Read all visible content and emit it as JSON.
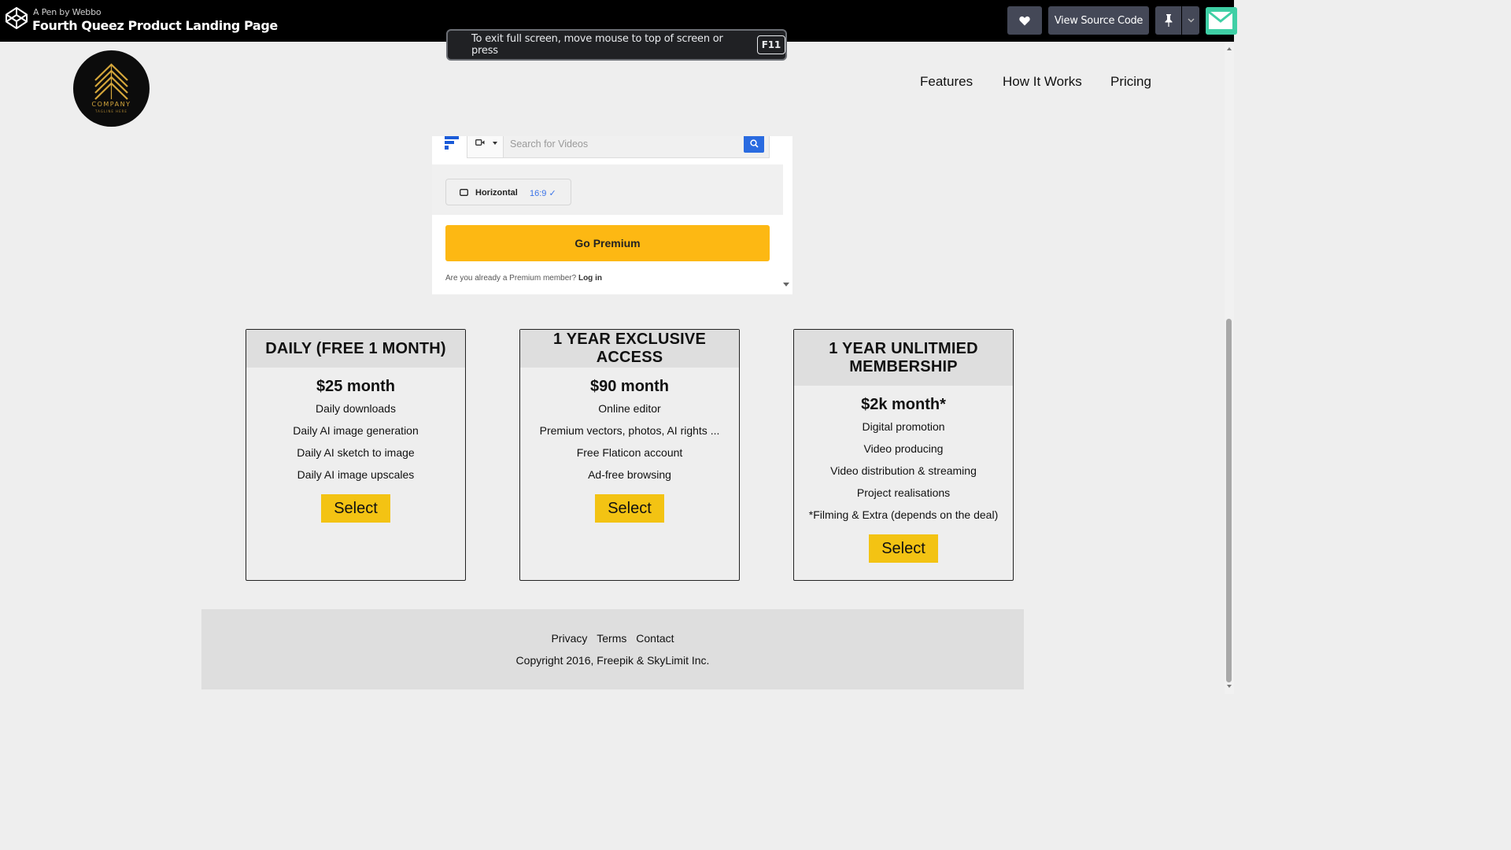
{
  "codepen": {
    "byline": "A Pen by Webbo",
    "title": "Fourth Queez Product Landing Page",
    "view_source_label": "View Source Code"
  },
  "fullscreen_notice": {
    "text": "To exit full screen, move mouse to top of screen or press",
    "key": "F11"
  },
  "site": {
    "logo_text": "COMPANY",
    "logo_tagline": "TAGLINE HERE",
    "nav": [
      "Features",
      "How It Works",
      "Pricing"
    ]
  },
  "widget": {
    "search_placeholder": "Search for Videos",
    "orientation_label": "Horizontal",
    "ratio_label": "16:9 ✓",
    "premium_button": "Go Premium",
    "login_prompt": "Are you already a Premium member?",
    "login_link": "Log in"
  },
  "plans": [
    {
      "title": "DAILY (FREE 1 MONTH)",
      "price": "$25 month",
      "features": [
        "Daily downloads",
        "Daily AI image generation",
        "Daily AI sketch to image",
        "Daily AI image upscales"
      ],
      "button": "Select"
    },
    {
      "title": "1 YEAR EXCLUSIVE ACCESS",
      "price": "$90 month",
      "features": [
        "Online editor",
        "Premium vectors, photos, AI rights ...",
        "Free Flaticon account",
        "Ad-free browsing"
      ],
      "button": "Select"
    },
    {
      "title": "1 YEAR UNLITMIED MEMBERSHIP",
      "price": "$2k month*",
      "features": [
        "Digital promotion",
        "Video producing",
        "Video distribution & streaming",
        "Project realisations",
        "*Filming & Extra (depends on the deal)"
      ],
      "button": "Select"
    }
  ],
  "footer": {
    "links": [
      "Privacy",
      "Terms",
      "Contact"
    ],
    "copyright": "Copyright 2016, Freepik & SkyLimit Inc."
  },
  "colors": {
    "accent_yellow": "#f3c313",
    "premium_orange": "#fdb813",
    "search_blue": "#2a6be0",
    "page_bg": "#eeeeee"
  }
}
